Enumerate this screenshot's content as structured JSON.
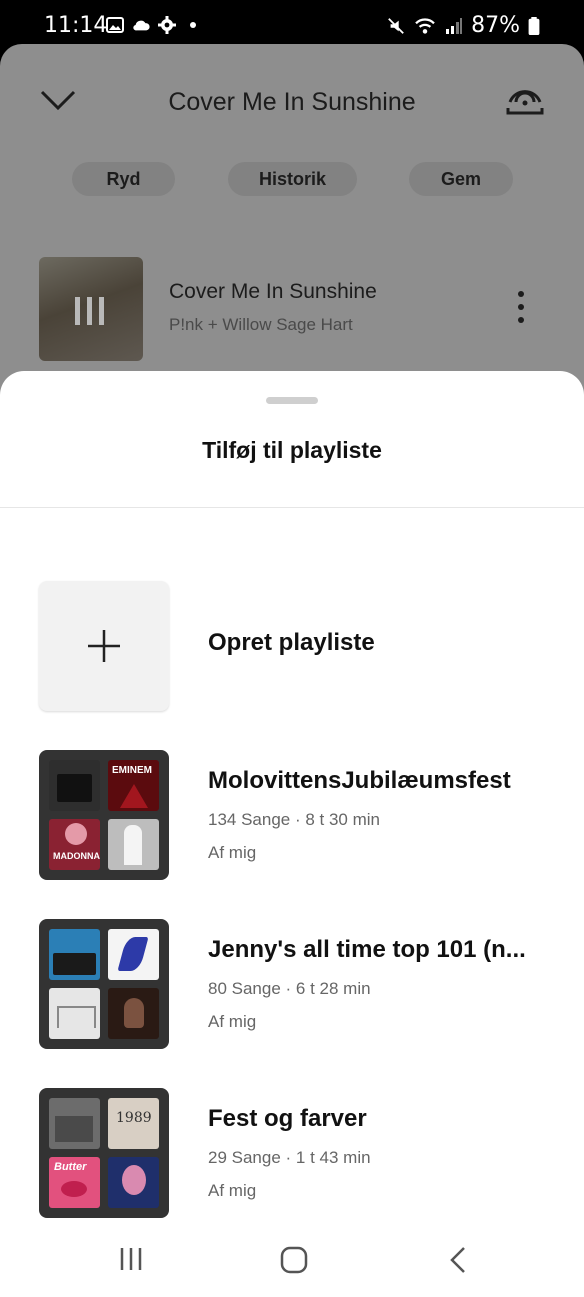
{
  "status": {
    "time": "11:14",
    "battery": "87%"
  },
  "player": {
    "title": "Cover Me In Sunshine",
    "chips": [
      "Ryd",
      "Historik",
      "Gem"
    ],
    "now_playing": {
      "title": "Cover Me In Sunshine",
      "artist": "P!nk + Willow Sage Hart"
    }
  },
  "sheet": {
    "title": "Tilføj til playliste",
    "create_label": "Opret playliste",
    "playlists": [
      {
        "title": "MolovittensJubilæumsfest",
        "meta": "134 Sange · 8 t 30 min",
        "owner": "Af mig",
        "tiles": [
          "#3a3a3a",
          "#6b0f12",
          "#7d1f2a",
          "#cfcfcf"
        ],
        "tile_labels": [
          "",
          "EMINEM",
          "MADONNA",
          ""
        ]
      },
      {
        "title": "Jenny's all time top 101 (n...",
        "meta": "80 Sange · 6 t 28 min",
        "owner": "Af mig",
        "tiles": [
          "#2b7fb6",
          "#f2f2f2",
          "#e8e8e8",
          "#2a1a14"
        ],
        "tile_labels": [
          "",
          "",
          "",
          ""
        ]
      },
      {
        "title": "Fest og farver",
        "meta": "29 Sange · 1 t 43 min",
        "owner": "Af mig",
        "tiles": [
          "#6c6c6c",
          "#d8cfc4",
          "#e2517e",
          "#1f2f6b"
        ],
        "tile_labels": [
          "",
          "1989",
          "Butter",
          ""
        ]
      }
    ]
  },
  "colors": {
    "dim_background": "#8e8e8e",
    "sheet": "#ffffff",
    "text_primary": "#111111",
    "text_secondary": "#666666"
  }
}
